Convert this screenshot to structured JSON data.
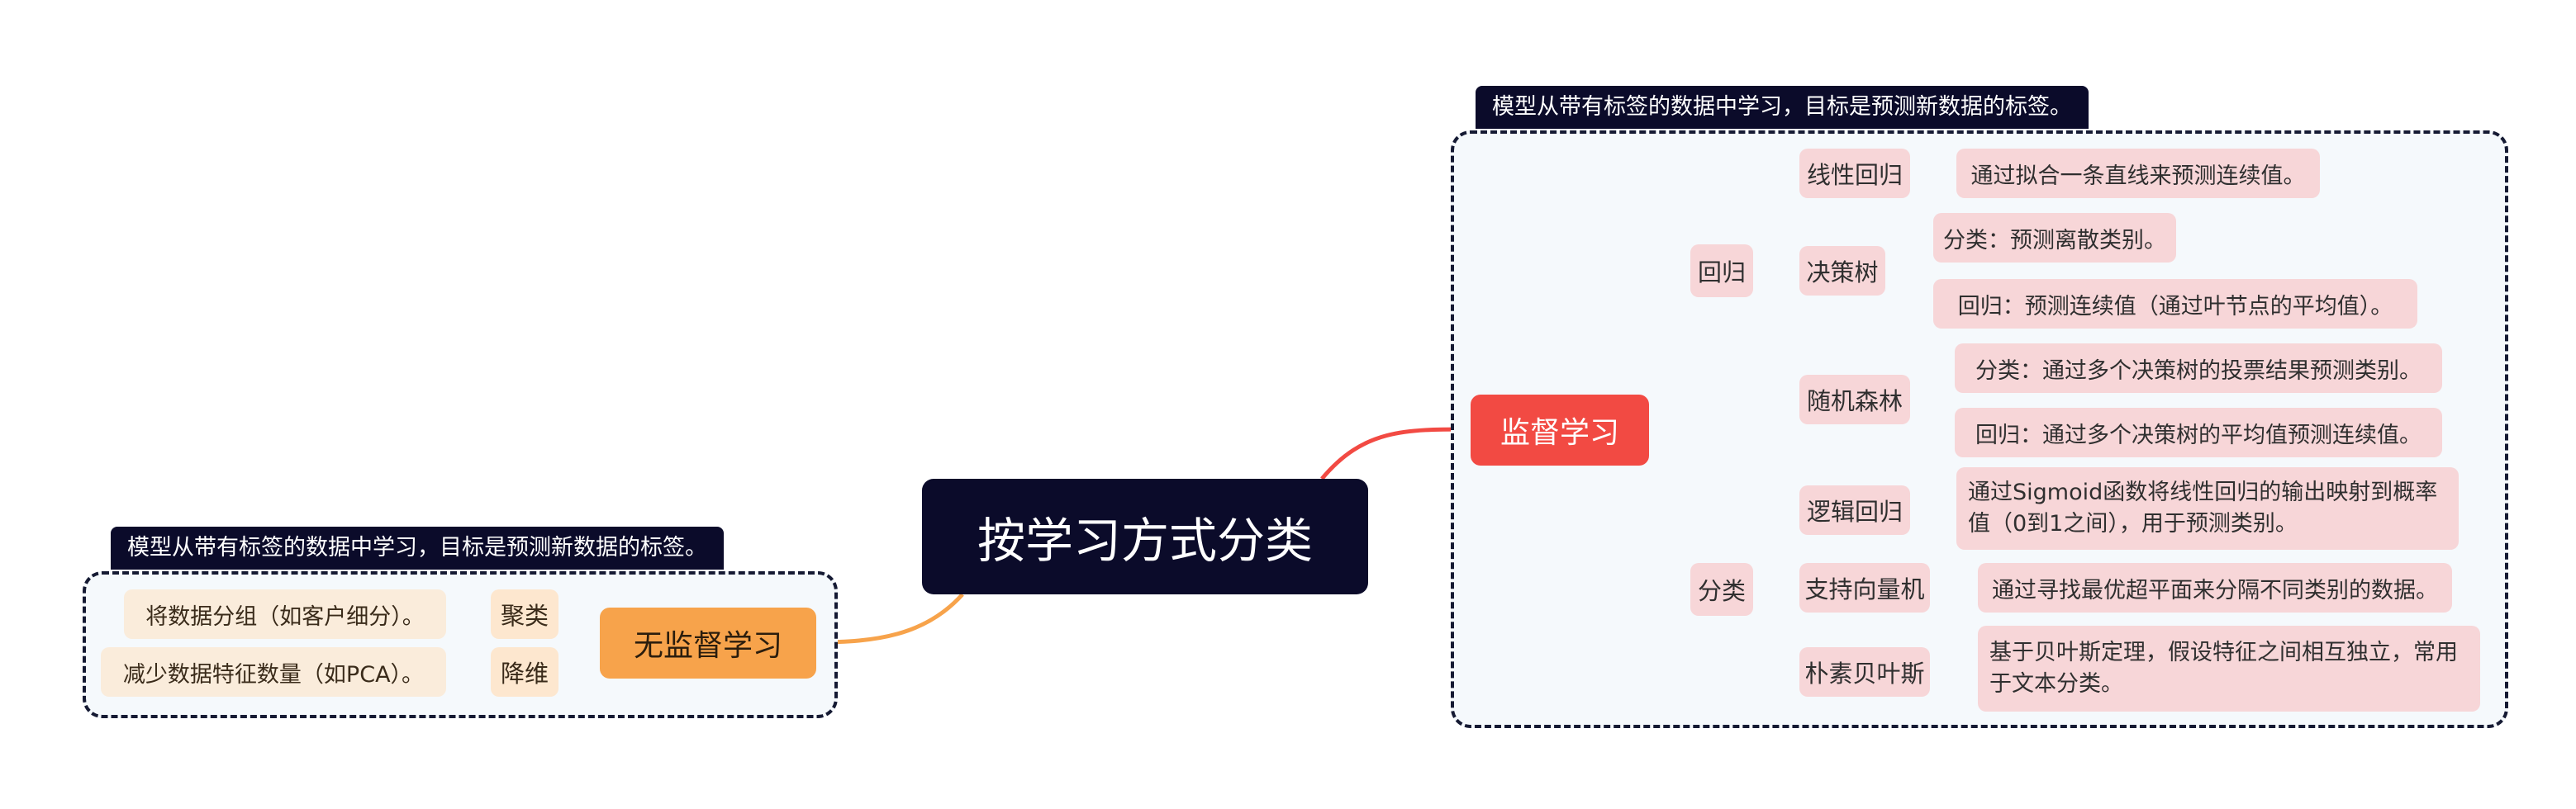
{
  "root": {
    "label": "按学习方式分类"
  },
  "supervised": {
    "label": "监督学习",
    "summary": "模型从带有标签的数据中学习，目标是预测新数据的标签。",
    "regression": {
      "label": "回归",
      "linear": {
        "label": "线性回归",
        "desc": "通过拟合一条直线来预测连续值。"
      },
      "tree": {
        "label": "决策树",
        "cls": "分类：预测离散类别。",
        "reg": "回归：预测连续值（通过叶节点的平均值）。"
      },
      "forest": {
        "label": "随机森林",
        "cls": "分类：通过多个决策树的投票结果预测类别。",
        "reg": "回归：通过多个决策树的平均值预测连续值。"
      }
    },
    "classification": {
      "label": "分类",
      "logistic": {
        "label": "逻辑回归",
        "desc": "通过Sigmoid函数将线性回归的输出映射到概率值（0到1之间），用于预测类别。"
      },
      "svm": {
        "label": "支持向量机",
        "desc": "通过寻找最优超平面来分隔不同类别的数据。"
      },
      "bayes": {
        "label": "朴素贝叶斯",
        "desc": "基于贝叶斯定理，假设特征之间相互独立，常用于文本分类。"
      }
    }
  },
  "unsupervised": {
    "label": "无监督学习",
    "summary": "模型从带有标签的数据中学习，目标是预测新数据的标签。",
    "clustering": {
      "label": "聚类",
      "desc": "将数据分组（如客户细分）。"
    },
    "reduction": {
      "label": "降维",
      "desc": "减少数据特征数量（如PCA）。"
    }
  },
  "colors": {
    "root": "#0b0b2a",
    "supervised": "#f24a43",
    "unsupervised": "#f7a34b",
    "supervised_light": "#f7d6d8",
    "unsupervised_light": "#fde7cf"
  }
}
